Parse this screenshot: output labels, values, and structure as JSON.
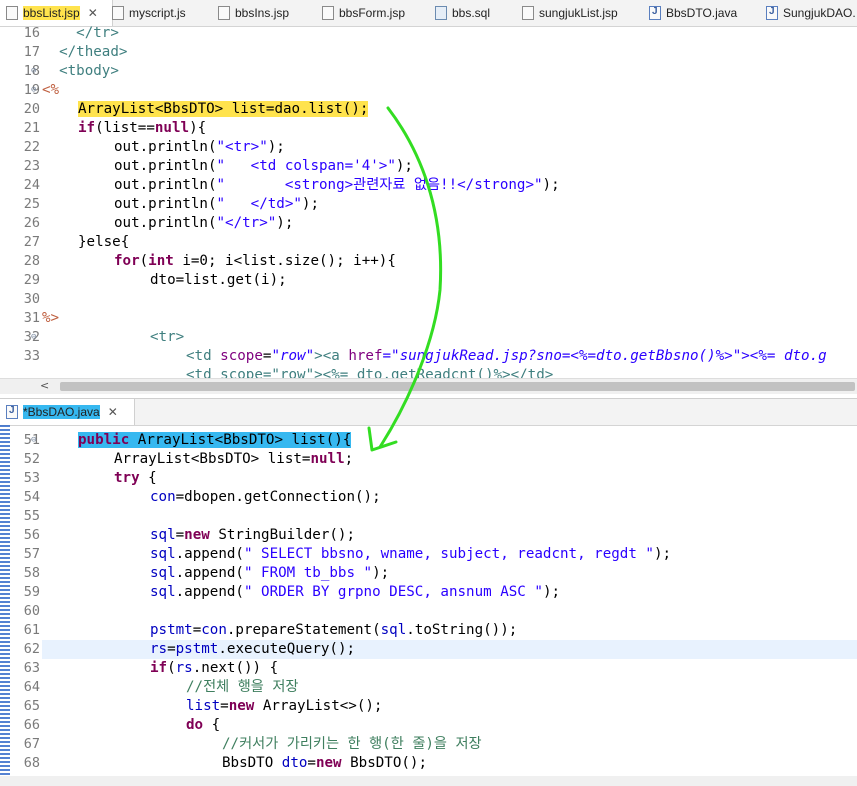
{
  "top_tabs": [
    {
      "label": "bbsList.jsp",
      "icon": "jsp-file-icon",
      "active": true,
      "close": "✕"
    },
    {
      "label": "myscript.js",
      "icon": "js-file-icon"
    },
    {
      "label": "bbsIns.jsp",
      "icon": "jsp-file-icon"
    },
    {
      "label": "bbsForm.jsp",
      "icon": "jsp-file-icon"
    },
    {
      "label": "bbs.sql",
      "icon": "sql-file-icon"
    },
    {
      "label": "sungjukList.jsp",
      "icon": "jsp-file-icon"
    },
    {
      "label": "BbsDTO.java",
      "icon": "java-file-icon"
    },
    {
      "label": "SungjukDAO.",
      "icon": "java-file-icon"
    }
  ],
  "top_lines": [
    "16",
    "17",
    "18",
    "19",
    "20",
    "21",
    "22",
    "23",
    "24",
    "25",
    "26",
    "27",
    "28",
    "29",
    "30",
    "31",
    "32",
    "33"
  ],
  "bottom_tab": {
    "label": "*BbsDAO.java",
    "icon": "java-file-icon",
    "close": "✕"
  },
  "bottom_lines": [
    "51",
    "52",
    "53",
    "54",
    "55",
    "56",
    "57",
    "58",
    "59",
    "60",
    "61",
    "62",
    "63",
    "64",
    "65",
    "66",
    "67",
    "68"
  ],
  "code": {
    "t16": "    </tr>",
    "t17_a": "  </thead>",
    "t18": "  <tbody>",
    "t19": "<%",
    "t20": "ArrayList<BbsDTO> list=dao.list();",
    "t21_kw": "if",
    "t21_a": "(list==",
    "t21_null": "null",
    "t21_b": "){",
    "t22_a": "out.println(",
    "t22_s": "\"<tr>\"",
    "t22_b": ");",
    "t23_s": "\"   <td colspan='4'>\"",
    "t24_s": "\"       <strong>관련자료 없음!!</strong>\"",
    "t25_s": "\"   </td>\"",
    "t26_s": "\"</tr>\"",
    "t27": "}else{",
    "t28_kw": "for",
    "t28_a": "(",
    "t28_int": "int",
    "t28_b": " i=0; i<list.size(); i++){",
    "t29": "dto=list.get(i);",
    "t31": "%>",
    "t32": "<tr>",
    "t33_a": "<td ",
    "t33_attr": "scope",
    "t33_eq": "=",
    "t33_row": "\"row\"",
    "t33_b": "><a ",
    "t33_href": "href",
    "t33_v": "=\"sungjukRead.jsp?sno=<%=dto.getBbsno()%>\"><%= dto.g",
    "t34": "<td scope=\"row\"><%= dto.getReadcnt()%></td>",
    "b51_kw": "public",
    "b51_a": " ArrayList<BbsDTO> list(){",
    "b52_a": "ArrayList<BbsDTO> list=",
    "b52_null": "null",
    "b52_b": ";",
    "b53_kw": "try",
    "b53_a": " {",
    "b54_fld": "con",
    "b54_a": "=dbopen.getConnection();",
    "b56_fld": "sql",
    "b56_a": "=",
    "b56_new": "new",
    "b56_b": " StringBuilder();",
    "append": ".append(",
    "b57_s": "\" SELECT bbsno, wname, subject, readcnt, regdt \"",
    "b58_s": "\" FROM tb_bbs \"",
    "b59_s": "\" ORDER BY grpno DESC, ansnum ASC \"",
    "close": ");",
    "b61_fld": "pstmt",
    "b61_a": "=",
    "b61_con": "con",
    "b61_b": ".prepareStatement(",
    "b61_sql": "sql",
    "b61_c": ".toString());",
    "b62_rs": "rs",
    "b62_a": "=",
    "b62_p": "pstmt",
    "b62_b": ".executeQuery(",
    "b62_c": ");",
    "b63_kw": "if",
    "b63_a": "(",
    "b63_rs": "rs",
    "b63_b": ".next()) {",
    "b64_c": "//전체 행을 저장",
    "b65_l": "list",
    "b65_a": "=",
    "b65_new": "new",
    "b65_b": " ArrayList<>();",
    "b66_kw": "do",
    "b66_a": " {",
    "b67_c": "//커서가 가리키는 한 행(한 줄)을 저장",
    "b68_a": "BbsDTO ",
    "b68_d": "dto",
    "b68_b": "=",
    "b68_new": "new",
    "b68_c": " BbsDTO();"
  },
  "colors": {
    "keyword": "#7f0055",
    "string": "#2a00ff",
    "comment": "#3f7f5f",
    "field": "#0000c0",
    "highlight_yellow": "#ffe34d",
    "highlight_cyan": "#36b8f0",
    "arrow": "#33dd22"
  }
}
